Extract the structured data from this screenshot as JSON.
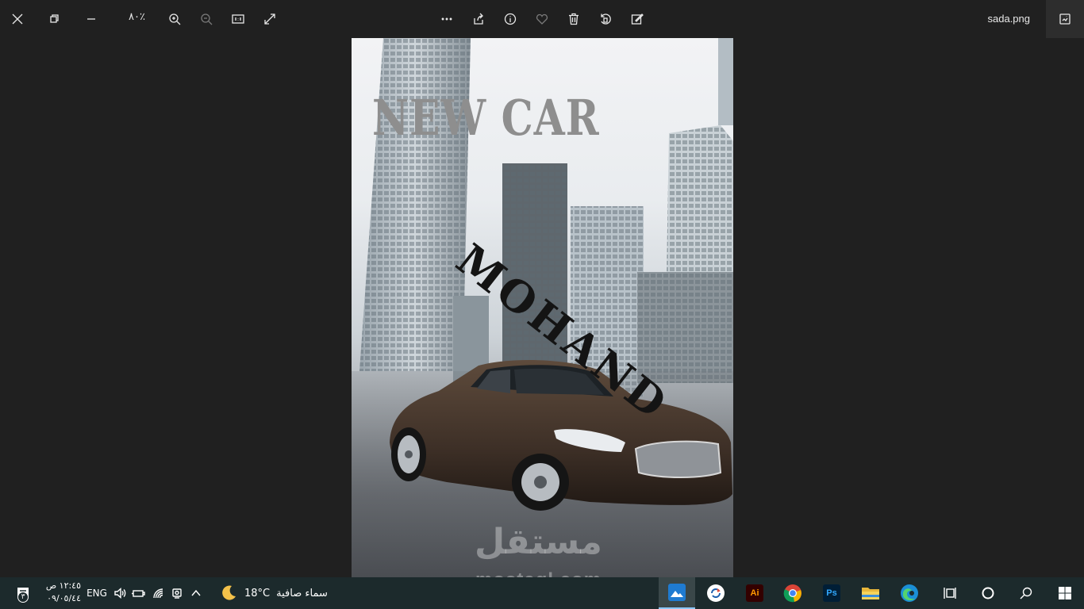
{
  "viewer": {
    "zoom_level": "٨٠٪",
    "file_name": "sada.png"
  },
  "toolbar_icons": [
    "close-icon",
    "restore-icon",
    "minimize-icon",
    "zoom-in-icon",
    "zoom-out-icon",
    "actual-size-icon",
    "fullscreen-icon",
    "more-icon",
    "share-icon",
    "info-icon",
    "favorite-icon",
    "delete-icon",
    "rotate-icon",
    "edit-icon",
    "filmstrip-icon"
  ],
  "photo": {
    "headline": "NEW CAR",
    "subtitle": "MOHAND",
    "watermark_arabic": "مستقل",
    "watermark_latin": "mostaql.com"
  },
  "taskbar": {
    "time": "١٢:٤٥ ص",
    "date": "٠٩/٠٥/٤٤",
    "notification_count": "٣",
    "language": "ENG",
    "temperature": "18°C",
    "weather_text": "سماء صافية",
    "colors": {
      "bg": "#1c2a2c",
      "accent": "#8cc8ff"
    }
  }
}
